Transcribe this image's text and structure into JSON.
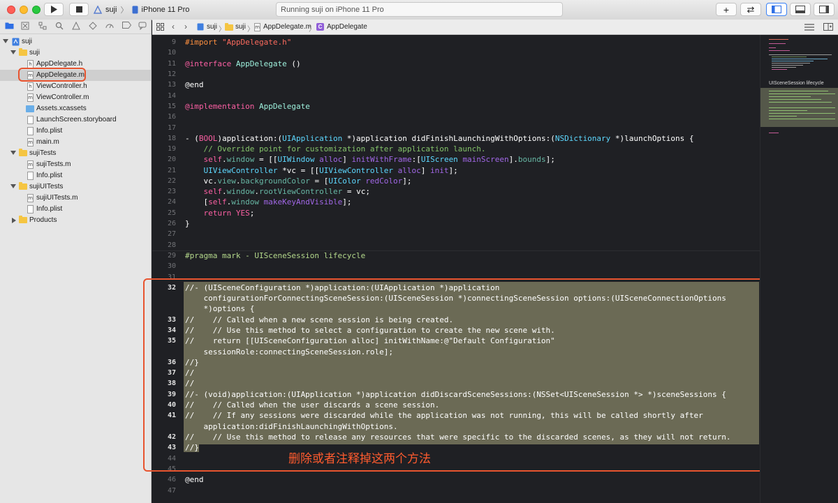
{
  "toolbar": {
    "scheme": "suji",
    "device": "iPhone 11 Pro",
    "status": "Running suji on iPhone 11 Pro",
    "add_symbol": "+",
    "swap_symbol": "⇄"
  },
  "navigator": {
    "items": [
      {
        "label": "suji",
        "kind": "project"
      },
      {
        "label": "suji",
        "kind": "folder"
      },
      {
        "label": "AppDelegate.h",
        "kind": "h"
      },
      {
        "label": "AppDelegate.m",
        "kind": "m"
      },
      {
        "label": "ViewController.h",
        "kind": "h"
      },
      {
        "label": "ViewController.m",
        "kind": "m"
      },
      {
        "label": "Assets.xcassets",
        "kind": "assets"
      },
      {
        "label": "LaunchScreen.storyboard",
        "kind": "storyboard"
      },
      {
        "label": "Info.plist",
        "kind": "plist"
      },
      {
        "label": "main.m",
        "kind": "m"
      },
      {
        "label": "sujiTests",
        "kind": "folder"
      },
      {
        "label": "sujiTests.m",
        "kind": "m"
      },
      {
        "label": "Info.plist",
        "kind": "plist"
      },
      {
        "label": "sujiUITests",
        "kind": "folder"
      },
      {
        "label": "sujiUITests.m",
        "kind": "m"
      },
      {
        "label": "Info.plist",
        "kind": "plist"
      },
      {
        "label": "Products",
        "kind": "folder"
      }
    ]
  },
  "jumpbar": {
    "crumbs": [
      "suji",
      "suji",
      "AppDelegate.m",
      "AppDelegate"
    ]
  },
  "editor": {
    "lines": [
      {
        "n": "9"
      },
      {
        "n": "10"
      },
      {
        "n": "11"
      },
      {
        "n": "12"
      },
      {
        "n": "13"
      },
      {
        "n": "14"
      },
      {
        "n": "15"
      },
      {
        "n": "16"
      },
      {
        "n": "17"
      },
      {
        "n": "18"
      },
      {
        "n": "19"
      },
      {
        "n": "20"
      },
      {
        "n": "21"
      },
      {
        "n": "22"
      },
      {
        "n": "23"
      },
      {
        "n": "24"
      },
      {
        "n": "25"
      },
      {
        "n": "26"
      },
      {
        "n": "27"
      },
      {
        "n": "28"
      },
      {
        "n": "29"
      },
      {
        "n": "30"
      },
      {
        "n": "31"
      },
      {
        "n": "32"
      },
      {
        "n": "33"
      },
      {
        "n": "34"
      },
      {
        "n": "35"
      },
      {
        "n": "36"
      },
      {
        "n": "37"
      },
      {
        "n": "38"
      },
      {
        "n": "39"
      },
      {
        "n": "40"
      },
      {
        "n": "41"
      },
      {
        "n": "42"
      },
      {
        "n": "43"
      },
      {
        "n": "44"
      },
      {
        "n": "45"
      },
      {
        "n": "46"
      },
      {
        "n": "47"
      }
    ],
    "code": {
      "l9a": "#import ",
      "l9b": "\"AppDelegate.h\"",
      "l11a": "@interface ",
      "l11b": "AppDelegate",
      "l11c": " ()",
      "l13": "@end",
      "l15a": "@implementation ",
      "l15b": "AppDelegate",
      "l18a": "- (",
      "l18b": "BOOL",
      "l18c": ")application:(",
      "l18d": "UIApplication",
      "l18e": " *)application didFinishLaunchingWithOptions:(",
      "l18f": "NSDictionary",
      "l18g": " *)launchOptions {",
      "l19": "    // Override point for customization after application launch.",
      "l20a": "    ",
      "l20b": "self",
      "l20c": ".",
      "l20d": "window",
      "l20e": " = [[",
      "l20f": "UIWindow",
      "l20g": " ",
      "l20h": "alloc",
      "l20i": "] ",
      "l20j": "initWithFrame",
      "l20k": ":[",
      "l20l": "UIScreen",
      "l20m": " ",
      "l20n": "mainScreen",
      "l20o": "].",
      "l20p": "bounds",
      "l20q": "];",
      "l21a": "    ",
      "l21b": "UIViewController",
      "l21c": " *vc = [[",
      "l21d": "UIViewController",
      "l21e": " ",
      "l21f": "alloc",
      "l21g": "] ",
      "l21h": "init",
      "l21i": "];",
      "l22a": "    vc.",
      "l22b": "view",
      "l22c": ".",
      "l22d": "backgroundColor",
      "l22e": " = [",
      "l22f": "UIColor",
      "l22g": " ",
      "l22h": "redColor",
      "l22i": "];",
      "l23a": "    ",
      "l23b": "self",
      "l23c": ".",
      "l23d": "window",
      "l23e": ".",
      "l23f": "rootViewController",
      "l23g": " = vc;",
      "l24a": "    [",
      "l24b": "self",
      "l24c": ".",
      "l24d": "window",
      "l24e": " ",
      "l24f": "makeKeyAndVisible",
      "l24g": "];",
      "l25a": "    ",
      "l25b": "return",
      "l25c": " ",
      "l25d": "YES",
      "l25e": ";",
      "l26": "}",
      "l29": "#pragma mark - UISceneSession lifecycle",
      "l32a": "//- (UISceneConfiguration *)application:(UIApplication *)application",
      "l32b": "    configurationForConnectingSceneSession:(UISceneSession *)connectingSceneSession options:(UISceneConnectionOptions",
      "l32c": "    *)options {",
      "l33": "//    // Called when a new scene session is being created.",
      "l34": "//    // Use this method to select a configuration to create the new scene with.",
      "l35a": "//    return [[UISceneConfiguration alloc] initWithName:@\"Default Configuration\"",
      "l35b": "    sessionRole:connectingSceneSession.role];",
      "l36": "//}",
      "l37": "//",
      "l38": "//",
      "l39": "//- (void)application:(UIApplication *)application didDiscardSceneSessions:(NSSet<UISceneSession *> *)sceneSessions {",
      "l40": "//    // Called when the user discards a scene session.",
      "l41a": "//    // If any sessions were discarded while the application was not running, this will be called shortly after",
      "l41b": "    application:didFinishLaunchingWithOptions.",
      "l42": "//    // Use this method to release any resources that were specific to the discarded scenes, as they will not return.",
      "l43": "//}",
      "l46": "@end"
    }
  },
  "minimap": {
    "label": "UISceneSession lifecycle"
  },
  "annotation": {
    "text": "删除或者注释掉这两个方法",
    "color": "#ff5b2e"
  },
  "colors": {
    "keyword": "#fc5fa3",
    "string": "#fc6a5d",
    "comment": "#6c7986",
    "preprocessor": "#fd8f3f",
    "type": "#5dd8ff",
    "highlight": "#6b6a55",
    "annotation_box": "#e8542f"
  }
}
